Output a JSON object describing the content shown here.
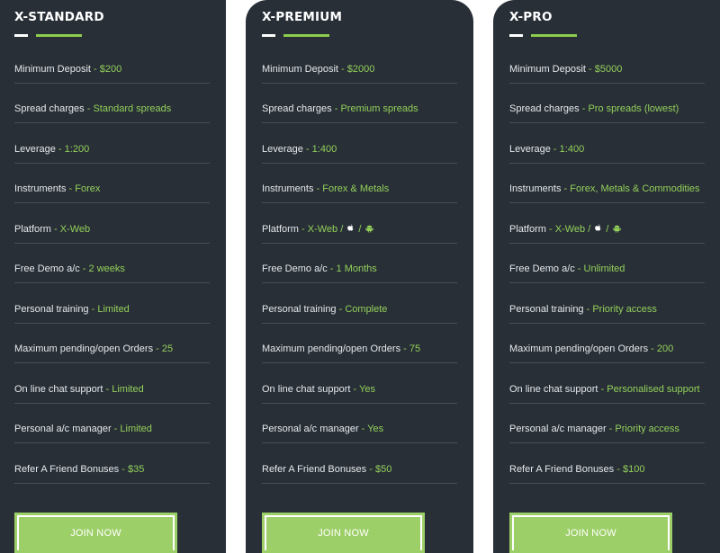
{
  "colors": {
    "card_bg": "#282f37",
    "accent_green": "#8fcd4f",
    "value_green": "#93d05a",
    "button_green": "#9dcf68"
  },
  "plans": [
    {
      "title": "X-STANDARD",
      "features": [
        {
          "label": "Minimum Deposit",
          "value": "$200"
        },
        {
          "label": "Spread charges",
          "value": "Standard spreads"
        },
        {
          "label": "Leverage",
          "value": "1:200"
        },
        {
          "label": "Instruments",
          "value": "Forex"
        },
        {
          "label": "Platform",
          "value": "X-Web"
        },
        {
          "label": "Free Demo a/c",
          "value": "2 weeks"
        },
        {
          "label": "Personal training",
          "value": "Limited"
        },
        {
          "label": "Maximum pending/open Orders",
          "value": "25"
        },
        {
          "label": "On line chat support",
          "value": "Limited"
        },
        {
          "label": "Personal a/c manager",
          "value": "Limited"
        },
        {
          "label": "Refer A Friend Bonuses",
          "value": "$35"
        }
      ],
      "button": "JOIN NOW"
    },
    {
      "title": "X-PREMIUM",
      "features": [
        {
          "label": "Minimum Deposit",
          "value": "$2000"
        },
        {
          "label": "Spread charges",
          "value": "Premium spreads"
        },
        {
          "label": "Leverage",
          "value": "1:400"
        },
        {
          "label": "Instruments",
          "value": "Forex & Metals"
        },
        {
          "label": "Platform",
          "value": "X-Web",
          "icons": [
            "apple-icon",
            "android-icon"
          ]
        },
        {
          "label": "Free Demo a/c",
          "value": "1 Months"
        },
        {
          "label": "Personal training",
          "value": "Complete"
        },
        {
          "label": "Maximum pending/open Orders",
          "value": "75"
        },
        {
          "label": "On line chat support",
          "value": "Yes"
        },
        {
          "label": "Personal a/c manager",
          "value": "Yes"
        },
        {
          "label": "Refer A Friend Bonuses",
          "value": "$50"
        }
      ],
      "button": "JOIN NOW"
    },
    {
      "title": "X-PRO",
      "features": [
        {
          "label": "Minimum Deposit",
          "value": "$5000"
        },
        {
          "label": "Spread charges",
          "value": "Pro spreads (lowest)"
        },
        {
          "label": "Leverage",
          "value": "1:400"
        },
        {
          "label": "Instruments",
          "value": "Forex, Metals & Commodities"
        },
        {
          "label": "Platform",
          "value": "X-Web",
          "icons": [
            "apple-icon",
            "android-icon"
          ]
        },
        {
          "label": "Free Demo a/c",
          "value": "Unlimited"
        },
        {
          "label": "Personal training",
          "value": "Priority access"
        },
        {
          "label": "Maximum pending/open Orders",
          "value": "200"
        },
        {
          "label": "On line chat support",
          "value": "Personalised support"
        },
        {
          "label": "Personal a/c manager",
          "value": "Priority access"
        },
        {
          "label": "Refer A Friend Bonuses",
          "value": "$100"
        }
      ],
      "button": "JOIN NOW"
    }
  ]
}
